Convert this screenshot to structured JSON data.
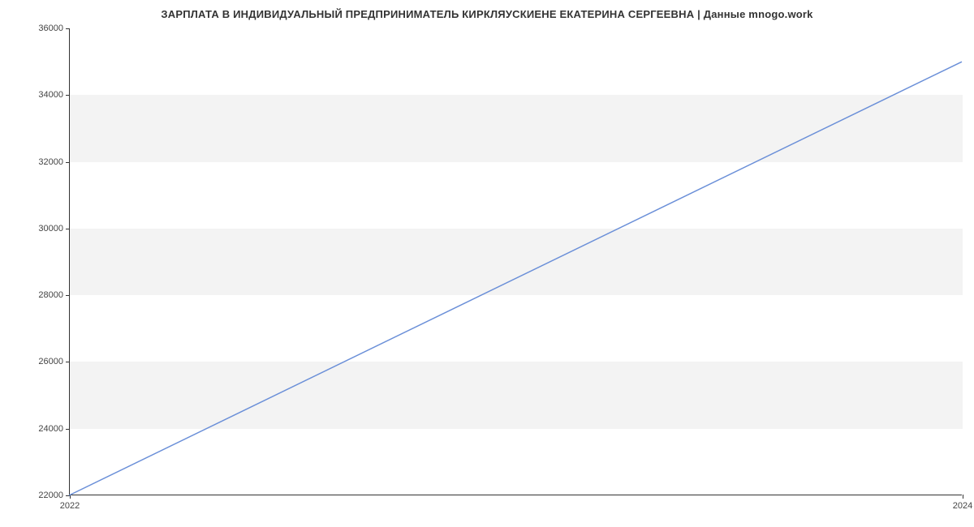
{
  "chart_data": {
    "type": "line",
    "title": "ЗАРПЛАТА В ИНДИВИДУАЛЬНЫЙ ПРЕДПРИНИМАТЕЛЬ КИРКЛЯУСКИЕНЕ ЕКАТЕРИНА СЕРГЕЕВНА | Данные mnogo.work",
    "x": [
      2022,
      2024
    ],
    "values": [
      22000,
      35000
    ],
    "xlabel": "",
    "ylabel": "",
    "xlim": [
      2022,
      2024
    ],
    "ylim": [
      22000,
      36000
    ],
    "x_ticks": [
      2022,
      2024
    ],
    "y_ticks": [
      22000,
      24000,
      26000,
      28000,
      30000,
      32000,
      34000,
      36000
    ],
    "grid_bands": [
      {
        "from": 24000,
        "to": 26000
      },
      {
        "from": 28000,
        "to": 30000
      },
      {
        "from": 32000,
        "to": 34000
      }
    ],
    "line_color": "#6a8fd8"
  }
}
